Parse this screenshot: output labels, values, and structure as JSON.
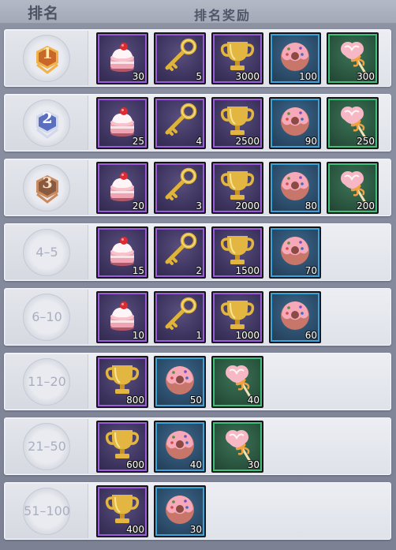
{
  "header": {
    "rank_label": "排名",
    "reward_label": "排名奖励"
  },
  "colors": {
    "purple_frame": "#9a5cd8",
    "blue_frame": "#3aa3d8",
    "green_frame": "#3fbf7a",
    "gold_medal": "#c9662a",
    "silver_medal": "#5b6fbf",
    "bronze_medal": "#8a5a40"
  },
  "rows": [
    {
      "rank": "1",
      "medal": "gold",
      "rewards": [
        {
          "icon": "cake-icon",
          "rarity": "purple",
          "count": "30"
        },
        {
          "icon": "key-icon",
          "rarity": "purple",
          "count": "5"
        },
        {
          "icon": "trophy-icon",
          "rarity": "purple",
          "count": "3000"
        },
        {
          "icon": "donut-icon",
          "rarity": "blue",
          "count": "100"
        },
        {
          "icon": "lollipop-icon",
          "rarity": "green",
          "count": "300"
        }
      ]
    },
    {
      "rank": "2",
      "medal": "silver",
      "rewards": [
        {
          "icon": "cake-icon",
          "rarity": "purple",
          "count": "25"
        },
        {
          "icon": "key-icon",
          "rarity": "purple",
          "count": "4"
        },
        {
          "icon": "trophy-icon",
          "rarity": "purple",
          "count": "2500"
        },
        {
          "icon": "donut-icon",
          "rarity": "blue",
          "count": "90"
        },
        {
          "icon": "lollipop-icon",
          "rarity": "green",
          "count": "250"
        }
      ]
    },
    {
      "rank": "3",
      "medal": "bronze",
      "rewards": [
        {
          "icon": "cake-icon",
          "rarity": "purple",
          "count": "20"
        },
        {
          "icon": "key-icon",
          "rarity": "purple",
          "count": "3"
        },
        {
          "icon": "trophy-icon",
          "rarity": "purple",
          "count": "2000"
        },
        {
          "icon": "donut-icon",
          "rarity": "blue",
          "count": "80"
        },
        {
          "icon": "lollipop-icon",
          "rarity": "green",
          "count": "200"
        }
      ]
    },
    {
      "rank": "4–5",
      "medal": "none",
      "rewards": [
        {
          "icon": "cake-icon",
          "rarity": "purple",
          "count": "15"
        },
        {
          "icon": "key-icon",
          "rarity": "purple",
          "count": "2"
        },
        {
          "icon": "trophy-icon",
          "rarity": "purple",
          "count": "1500"
        },
        {
          "icon": "donut-icon",
          "rarity": "blue",
          "count": "70"
        }
      ]
    },
    {
      "rank": "6–10",
      "medal": "none",
      "rewards": [
        {
          "icon": "cake-icon",
          "rarity": "purple",
          "count": "10"
        },
        {
          "icon": "key-icon",
          "rarity": "purple",
          "count": "1"
        },
        {
          "icon": "trophy-icon",
          "rarity": "purple",
          "count": "1000"
        },
        {
          "icon": "donut-icon",
          "rarity": "blue",
          "count": "60"
        }
      ]
    },
    {
      "rank": "11–20",
      "medal": "none",
      "rewards": [
        {
          "icon": "trophy-icon",
          "rarity": "purple",
          "count": "800"
        },
        {
          "icon": "donut-icon",
          "rarity": "blue",
          "count": "50"
        },
        {
          "icon": "lollipop-icon",
          "rarity": "green",
          "count": "40"
        }
      ]
    },
    {
      "rank": "21–50",
      "medal": "none",
      "rewards": [
        {
          "icon": "trophy-icon",
          "rarity": "purple",
          "count": "600"
        },
        {
          "icon": "donut-icon",
          "rarity": "blue",
          "count": "40"
        },
        {
          "icon": "lollipop-icon",
          "rarity": "green",
          "count": "30"
        }
      ]
    },
    {
      "rank": "51–100",
      "medal": "none",
      "rewards": [
        {
          "icon": "trophy-icon",
          "rarity": "purple",
          "count": "400"
        },
        {
          "icon": "donut-icon",
          "rarity": "blue",
          "count": "30"
        }
      ]
    }
  ]
}
